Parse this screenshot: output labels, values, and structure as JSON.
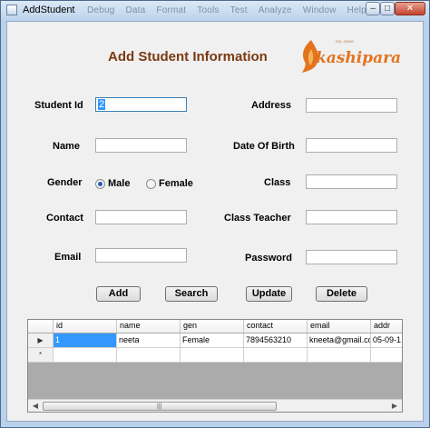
{
  "window": {
    "title": "AddStudent",
    "ghost_menu": [
      "Debug",
      "Data",
      "Format",
      "Tools",
      "Test",
      "Analyze",
      "Window",
      "Help"
    ],
    "controls": {
      "minimize": "–",
      "maximize": "□",
      "close": "✕"
    }
  },
  "form": {
    "heading": "Add Student Information",
    "logo": {
      "text": "kashipara",
      "small_text": "ESL 20306"
    },
    "labels": {
      "student_id": "Student Id",
      "name": "Name",
      "gender": "Gender",
      "contact": "Contact",
      "email": "Email",
      "address": "Address",
      "dob": "Date Of Birth",
      "class": "Class",
      "class_teacher": "Class Teacher",
      "password": "Password"
    },
    "values": {
      "student_id": "2",
      "name": "",
      "contact": "",
      "email": "",
      "address": "",
      "dob": "",
      "class": "",
      "class_teacher": "",
      "password": ""
    },
    "gender_options": [
      {
        "label": "Male",
        "selected": true
      },
      {
        "label": "Female",
        "selected": false
      }
    ],
    "buttons": {
      "add": "Add",
      "search": "Search",
      "update": "Update",
      "delete": "Delete"
    }
  },
  "grid": {
    "columns": [
      "id",
      "name",
      "gen",
      "contact",
      "email",
      "addr"
    ],
    "rows": [
      {
        "marker": "▶",
        "cells": [
          "1",
          "neeta",
          "Female",
          "7894563210",
          "kneeta@gmail.com",
          "05-09-1"
        ]
      },
      {
        "marker": "*",
        "cells": [
          "",
          "",
          "",
          "",
          "",
          ""
        ]
      }
    ],
    "scrollbar": {
      "left_arrow": "◀",
      "right_arrow": "▶",
      "grip": "|||"
    }
  }
}
